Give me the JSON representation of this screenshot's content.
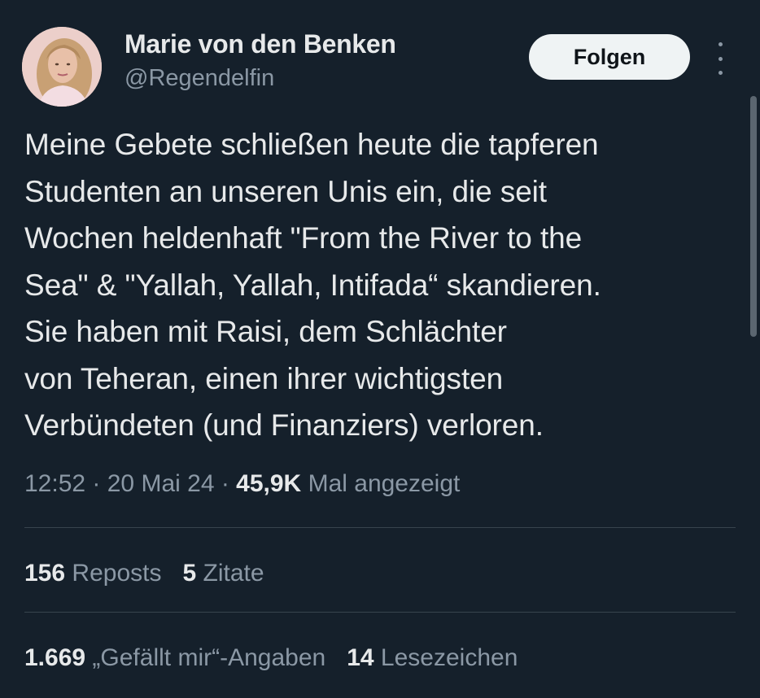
{
  "author": {
    "display_name": "Marie von den Benken",
    "handle": "@Regendelfin",
    "avatar_icon": "profile-photo"
  },
  "follow_label": "Folgen",
  "more_icon": "more-vertical-icon",
  "tweet": {
    "text": "Meine Gebete schließen heute die tapferen\nStudenten an unseren Unis ein, die seit\nWochen heldenhaft \"From the River to the\nSea\" & \"Yallah, Yallah, Intifada“ skandieren.\nSie haben mit Raisi, dem Schlächter\nvon Teheran, einen ihrer wichtigsten\nVerbündeten (und Finanziers) verloren."
  },
  "meta": {
    "time": "12:52",
    "separator": " · ",
    "date": "20 Mai 24",
    "views_count": "45,9K",
    "views_label": "Mal angezeigt"
  },
  "stats": {
    "reposts_count": "156",
    "reposts_label": "Reposts",
    "quotes_count": "5",
    "quotes_label": "Zitate",
    "likes_count": "1.669",
    "likes_label": "„Gefällt mir“-Angaben",
    "bookmarks_count": "14",
    "bookmarks_label": "Lesezeichen"
  },
  "colors": {
    "background": "#15202b",
    "text": "#e7e9ea",
    "secondary_text": "#8b98a5",
    "divider": "#38444d",
    "button_bg": "#eff3f4"
  }
}
